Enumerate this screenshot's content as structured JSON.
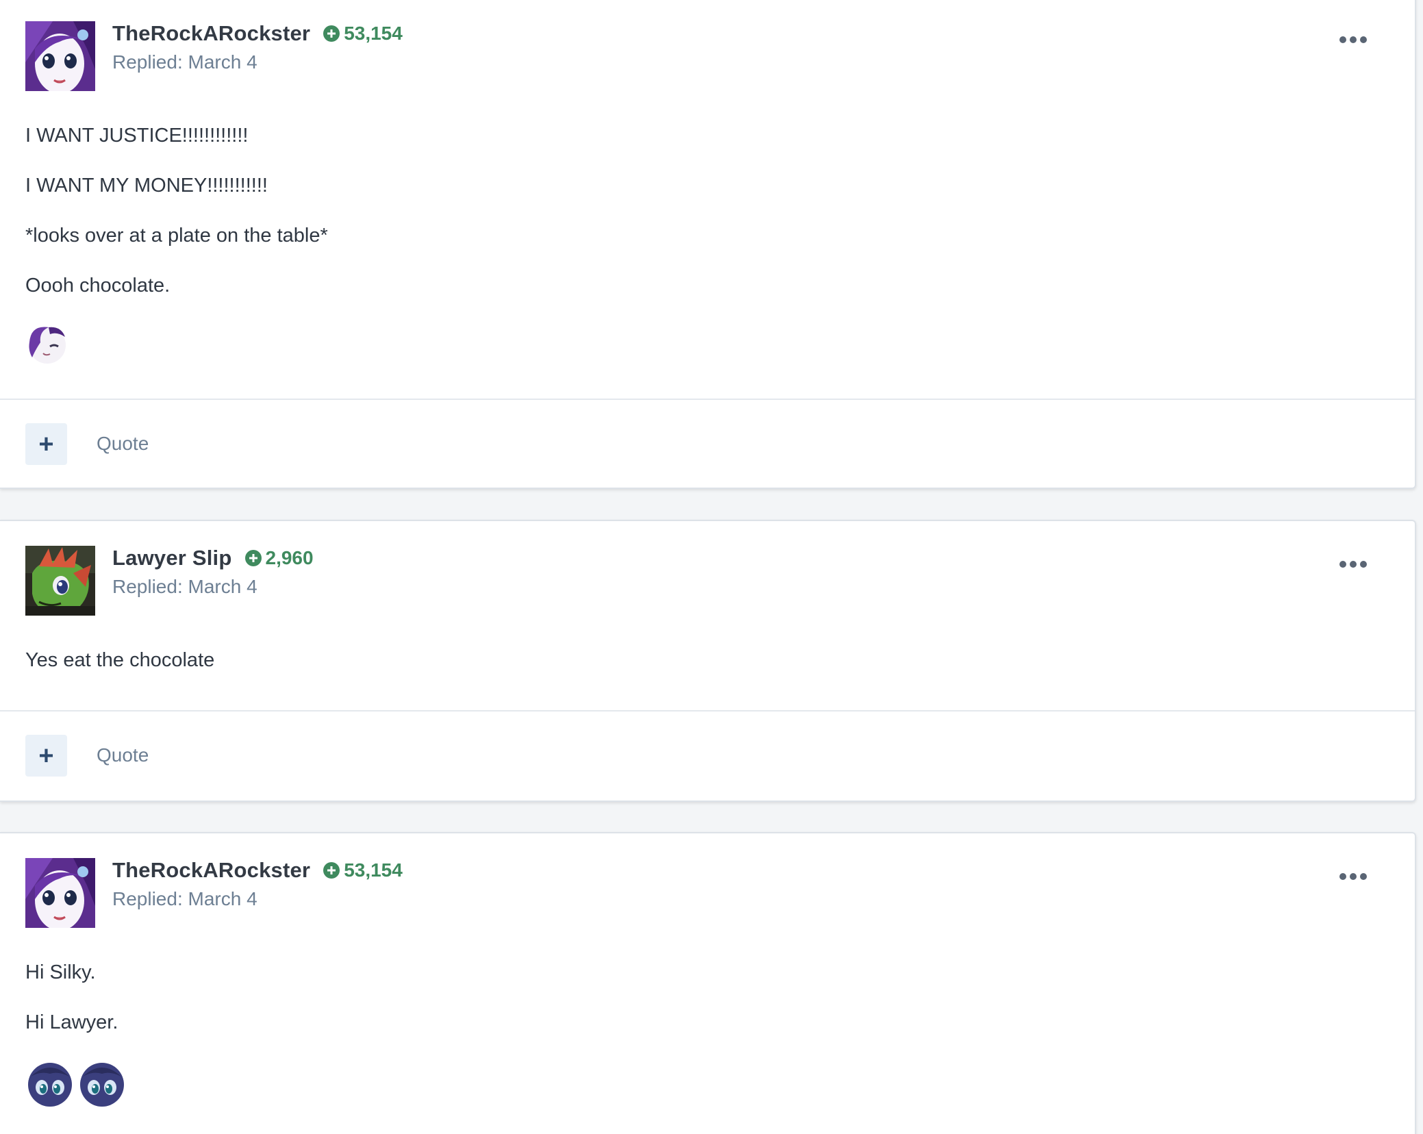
{
  "posts": [
    {
      "author": "TheRockARockster",
      "reputation": "53,154",
      "replied": "Replied: March 4",
      "paragraphs": [
        "I WANT JUSTICE!!!!!!!!!!!!",
        "I WANT MY MONEY!!!!!!!!!!!",
        "*looks over at a plate on the table*",
        "Oooh chocolate."
      ],
      "emojis": [
        "rarity-wink-emoji"
      ],
      "footer": {
        "plus_label": "+",
        "quote_label": "Quote"
      }
    },
    {
      "author": "Lawyer Slip",
      "reputation": "2,960",
      "replied": "Replied: March 4",
      "paragraphs": [
        "Yes eat the chocolate"
      ],
      "emojis": [],
      "footer": {
        "plus_label": "+",
        "quote_label": "Quote"
      }
    },
    {
      "author": "TheRockARockster",
      "reputation": "53,154",
      "replied": "Replied: March 4",
      "paragraphs": [
        "Hi Silky.",
        "Hi Lawyer."
      ],
      "emojis": [
        "luna-face-emoji",
        "luna-face-emoji"
      ]
    }
  ],
  "colors": {
    "reputation": "#3f8a5e",
    "meta_text": "#6d7f93",
    "author_text": "#333a44",
    "plus_button_bg": "#eaf1f8"
  }
}
